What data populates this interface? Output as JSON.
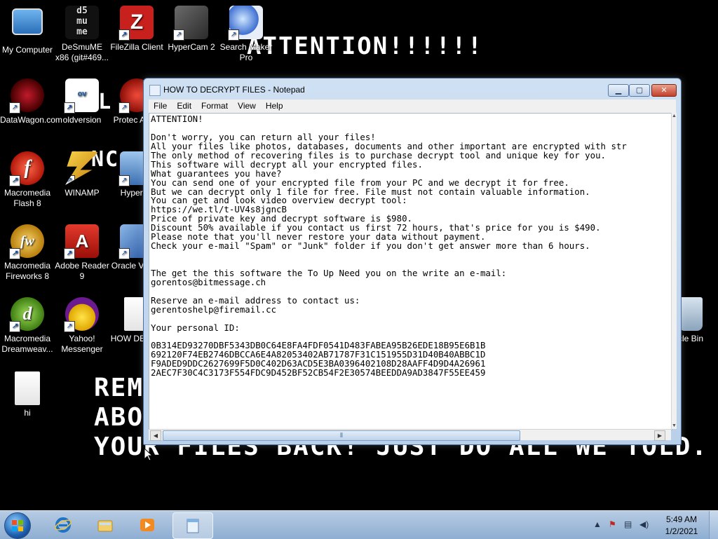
{
  "wallpaper": {
    "attention": "ATTENTION!!!!!!",
    "line1": "REM",
    "line2": "ABO",
    "line3": "YOUR FILES BACK! JUST DO ALL WE TOLD.",
    "frag_a": "ALL",
    "frag_b": "NC"
  },
  "desktop_icons": [
    {
      "label": "My Computer",
      "icon": "computer-icon"
    },
    {
      "label": "DeSmuME x86 (git#469...",
      "icon": "desmume-icon"
    },
    {
      "label": "FileZilla Client",
      "icon": "filezilla-icon"
    },
    {
      "label": "HyperCam 2",
      "icon": "hypercam-icon"
    },
    {
      "label": "Search Maker Pro",
      "icon": "search-maker-icon"
    },
    {
      "label": "DataWagon.com",
      "icon": "datawagon-icon"
    },
    {
      "label": "oldversion",
      "icon": "oldversion-icon"
    },
    {
      "label": "Protec Antivi",
      "icon": "antivirus-icon"
    },
    {
      "label": "Macromedia Flash 8",
      "icon": "flash-icon"
    },
    {
      "label": "WINAMP",
      "icon": "winamp-icon"
    },
    {
      "label": "HyperSn",
      "icon": "hypersnap-icon"
    },
    {
      "label": "Macromedia Fireworks 8",
      "icon": "fireworks-icon"
    },
    {
      "label": "Adobe Reader 9",
      "icon": "adobe-reader-icon"
    },
    {
      "label": "Oracle Virtual",
      "icon": "virtualbox-icon"
    },
    {
      "label": "Macromedia Dreamweav...",
      "icon": "dreamweaver-icon"
    },
    {
      "label": "Yahoo! Messenger",
      "icon": "yahoo-messenger-icon"
    },
    {
      "label": "HOW DECRY",
      "icon": "text-file-icon"
    },
    {
      "label": "hi",
      "icon": "text-file-icon"
    },
    {
      "label": "cle Bin",
      "icon": "recycle-bin-icon"
    }
  ],
  "notepad": {
    "title": "HOW TO DECRYPT FILES - Notepad",
    "min_label": "▁",
    "max_label": "▢",
    "close_label": "✕",
    "menu": [
      "File",
      "Edit",
      "Format",
      "View",
      "Help"
    ],
    "lines": [
      "ATTENTION!",
      "",
      "Don't worry, you can return all your files!",
      "All your files like photos, databases, documents and other important are encrypted with str",
      "The only method of recovering files is to purchase decrypt tool and unique key for you.",
      "This software will decrypt all your encrypted files.",
      "What guarantees you have?",
      "You can send one of your encrypted file from your PC and we decrypt it for free.",
      "But we can decrypt only 1 file for free. File must not contain valuable information.",
      "You can get and look video overview decrypt tool:",
      "https://we.tl/t-UV4s8jgncB",
      "Price of private key and decrypt software is $980.",
      "Discount 50% available if you contact us first 72 hours, that's price for you is $490.",
      "Please note that you'll never restore your data without payment.",
      "Check your e-mail \"Spam\" or \"Junk\" folder if you don't get answer more than 6 hours.",
      "",
      "",
      "The get the this software the To Up Need you on the write an e-mail:",
      "gorentos@bitmessage.ch",
      "",
      "Reserve an e-mail address to contact us:",
      "gerentoshelp@firemail.cc",
      "",
      "Your personal ID:",
      "",
      "0B314ED93270DBF5343DB0C64E8FA4FDF0541D483FABEA95B26EDE18B95E6B1B",
      "692120F74EB2746DBCCA6E4A82053402AB71787F31C151955D31D40B40ABBC1D",
      "F9ADED9DDC2627699F5D0C402D63ACD5E3BA0396402108D28AAFF4D9D4A26961",
      "2AEC7F30C4C3173F554FDC9D452BF52CB54F2E30574BEEDDA9AD3847F55EE459"
    ],
    "hscroll_grip": "⦀",
    "hscroll_left": "◀",
    "hscroll_right": "▶",
    "vscroll_up": "▲",
    "vscroll_down": "▼"
  },
  "taskbar": {
    "buttons": [
      "start-orb",
      "internet-explorer-icon",
      "windows-explorer-icon",
      "media-player-icon",
      "notepad-icon"
    ],
    "tray": {
      "arrow": "▲",
      "flag": "⚑",
      "network": "▤",
      "volume": "◀)"
    },
    "time": "5:49 AM",
    "date": "1/2/2021"
  }
}
